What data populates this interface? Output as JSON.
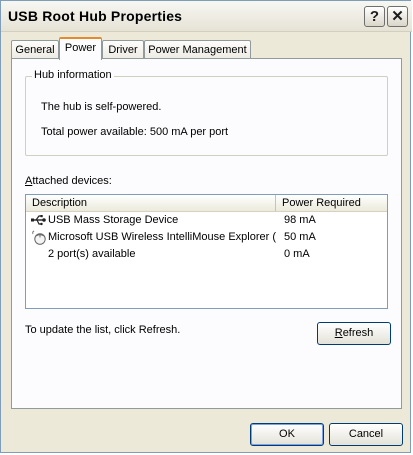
{
  "window": {
    "title": "USB Root Hub Properties",
    "help_glyph": "?",
    "close_glyph": "✕"
  },
  "tabs": [
    {
      "label": "General",
      "active": false
    },
    {
      "label": "Power",
      "active": true
    },
    {
      "label": "Driver",
      "active": false
    },
    {
      "label": "Power Management",
      "active": false
    }
  ],
  "hub_info": {
    "group_label": "Hub information",
    "line1": "The hub is self-powered.",
    "line2": "Total power available:  500 mA per port"
  },
  "attached": {
    "label_access": "A",
    "label_rest": "ttached devices:",
    "columns": [
      "Description",
      "Power Required"
    ],
    "rows": [
      {
        "icon": "usb-storage-icon",
        "description": "USB Mass Storage Device",
        "power": "98 mA"
      },
      {
        "icon": "mouse-icon",
        "description": "Microsoft USB Wireless IntelliMouse Explorer (I...",
        "power": "50 mA"
      },
      {
        "icon": "",
        "description": "2 port(s) available",
        "power": "0 mA"
      }
    ]
  },
  "update_hint": "To update the list, click Refresh.",
  "refresh_button": {
    "access": "R",
    "rest": "efresh"
  },
  "ok_label": "OK",
  "cancel_label": "Cancel",
  "colors": {
    "accent_tab": "#e68b2c",
    "window_bg": "#ece9d8",
    "panel_bg": "#fcfcfe"
  }
}
